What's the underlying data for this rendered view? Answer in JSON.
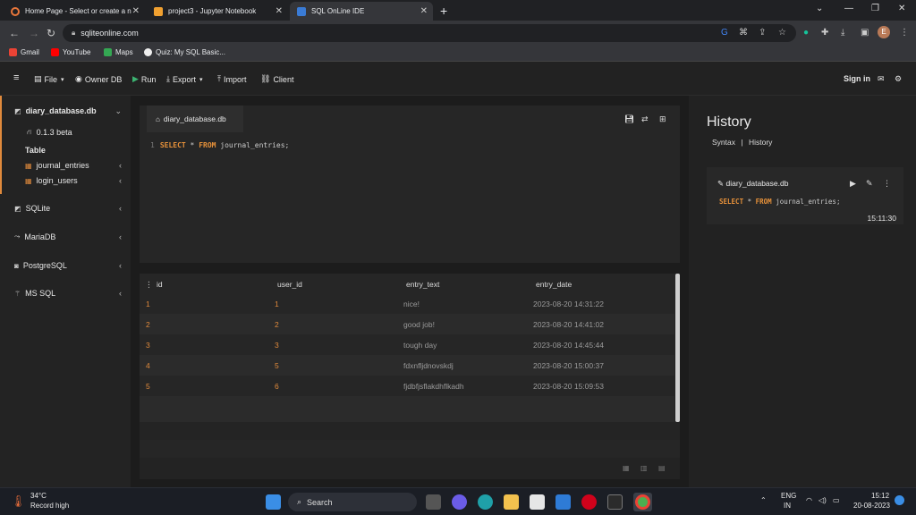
{
  "browser": {
    "tabs": [
      {
        "title": "Home Page - Select or create a n",
        "color": "#e8763a"
      },
      {
        "title": "project3 - Jupyter Notebook",
        "color": "#f0a030"
      },
      {
        "title": "SQL OnLine IDE",
        "color": "#3a7bd5"
      }
    ],
    "url": "sqliteonline.com",
    "profile_initial": "E",
    "bookmarks": [
      {
        "label": "Gmail",
        "color": "#ea4335"
      },
      {
        "label": "YouTube",
        "color": "#ff0000"
      },
      {
        "label": "Maps",
        "color": "#34a853"
      },
      {
        "label": "Quiz: My SQL Basic...",
        "color": "#eeeeee"
      }
    ]
  },
  "toolbar": {
    "file": "File",
    "owner_db": "Owner DB",
    "run": "Run",
    "export": "Export",
    "import": "Import",
    "client": "Client",
    "sign_in": "Sign in"
  },
  "sidebar": {
    "db_name": "diary_database.db",
    "version": "0.1.3 beta",
    "table_heading": "Table",
    "tables": [
      "journal_entries",
      "login_users"
    ],
    "engines": [
      "SQLite",
      "MariaDB",
      "PostgreSQL",
      "MS SQL"
    ]
  },
  "editor": {
    "tab_name": "diary_database.db",
    "line_number": "1",
    "kw_select": "SELECT",
    "star": " * ",
    "kw_from": "FROM",
    "table": " journal_entries;"
  },
  "results": {
    "columns": [
      "id",
      "user_id",
      "entry_text",
      "entry_date"
    ],
    "rows": [
      {
        "id": "1",
        "user_id": "1",
        "entry_text": "nice!",
        "entry_date": "2023-08-20 14:31:22"
      },
      {
        "id": "2",
        "user_id": "2",
        "entry_text": "good job!",
        "entry_date": "2023-08-20 14:41:02"
      },
      {
        "id": "3",
        "user_id": "3",
        "entry_text": "tough day",
        "entry_date": "2023-08-20 14:45:44"
      },
      {
        "id": "4",
        "user_id": "5",
        "entry_text": "fdxnfljdnovskdj",
        "entry_date": "2023-08-20 15:00:37"
      },
      {
        "id": "5",
        "user_id": "6",
        "entry_text": "fjdbfjsflakdhflkadh",
        "entry_date": "2023-08-20 15:09:53"
      }
    ]
  },
  "history": {
    "title": "History",
    "nav_syntax": "Syntax",
    "nav_sep": "|",
    "nav_history": "History",
    "card_db": "diary_database.db",
    "card_kw_select": "SELECT",
    "card_star": " * ",
    "card_kw_from": "FROM",
    "card_table": " journal_entries;",
    "card_time": "15:11:30"
  },
  "taskbar": {
    "weather_temp": "34°C",
    "weather_desc": "Record high",
    "search_placeholder": "Search",
    "lang": "ENG",
    "region": "IN",
    "time": "15:12",
    "date": "20-08-2023"
  },
  "colors": {
    "accent": "#e08a3c",
    "run": "#3cb371"
  }
}
